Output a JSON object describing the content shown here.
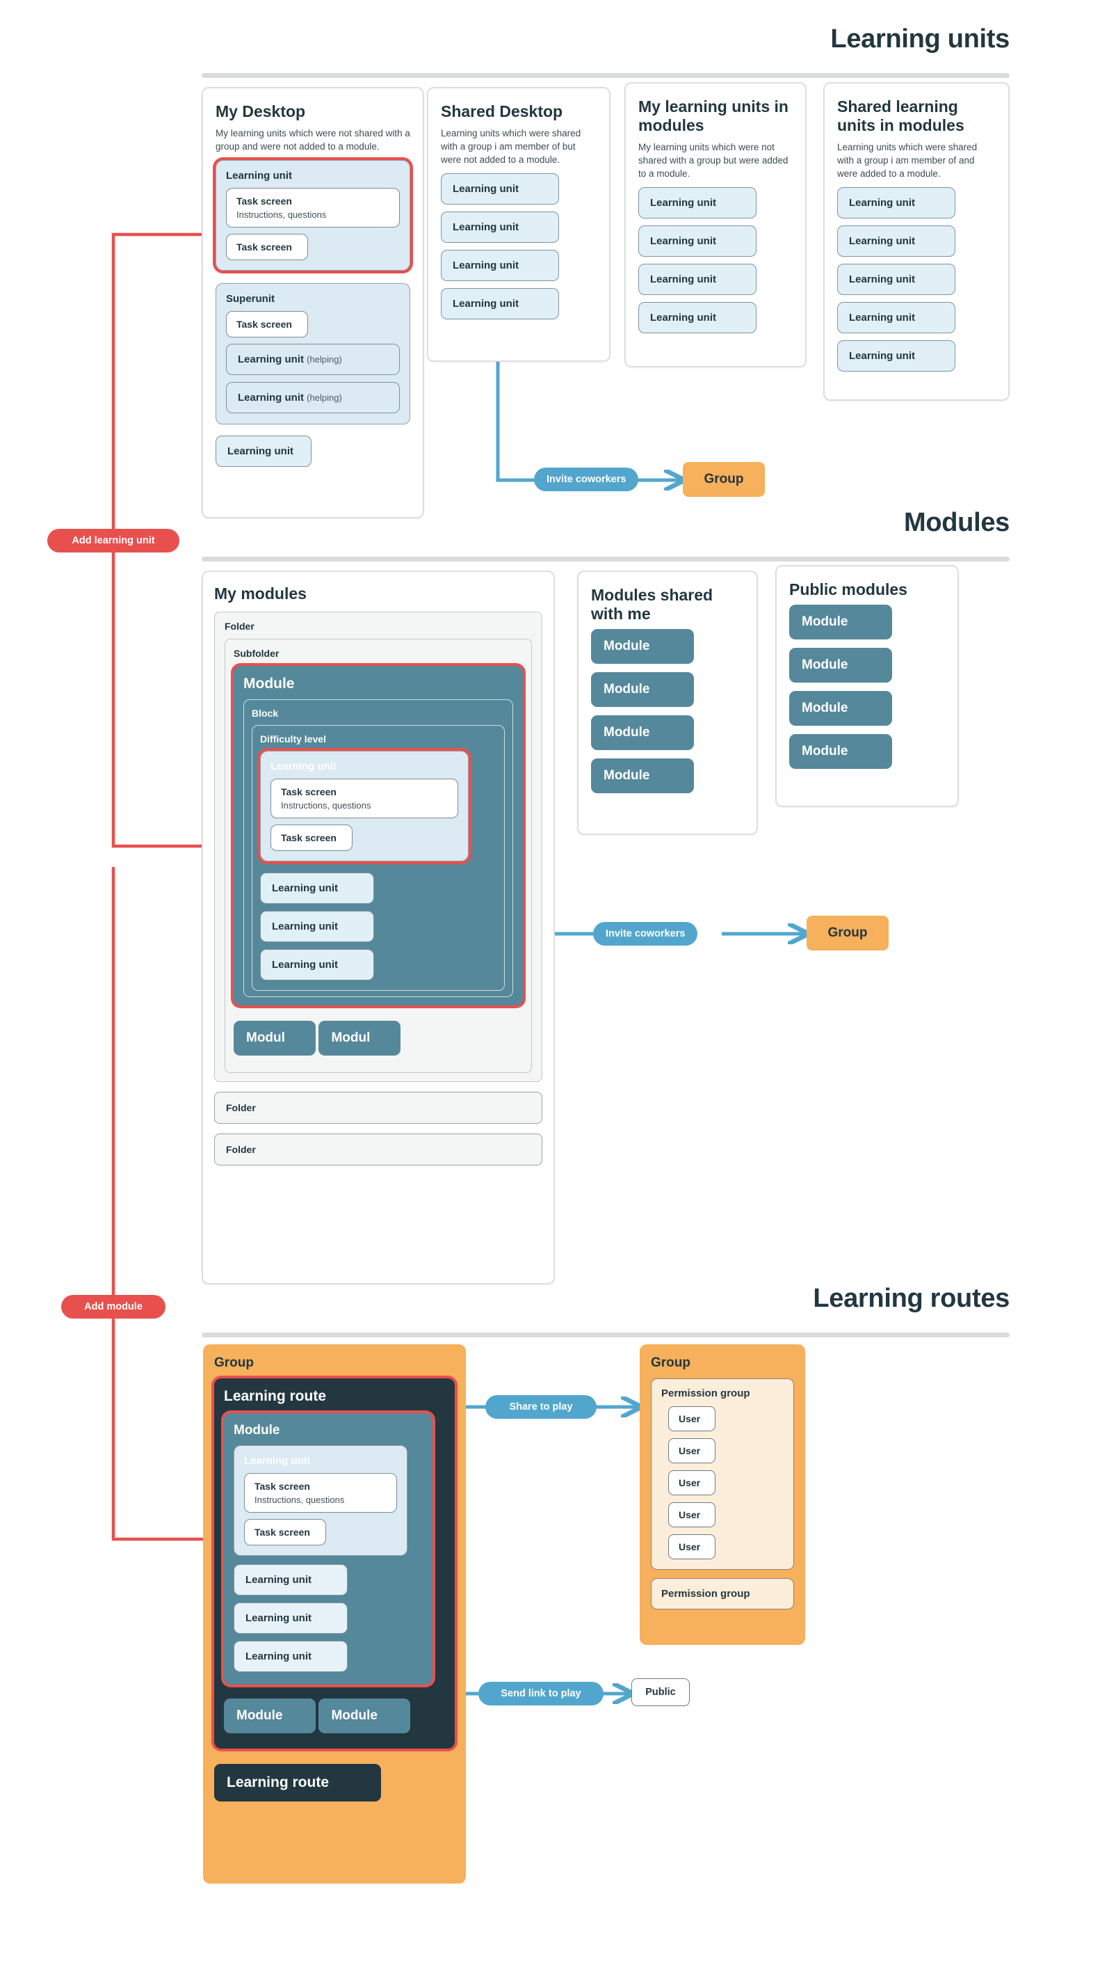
{
  "sections": [
    {
      "id": "learning-units",
      "title": "Learning units"
    },
    {
      "id": "modules",
      "title": "Modules"
    },
    {
      "id": "learning-routes",
      "title": "Learning routes"
    }
  ],
  "colors": {
    "accent_red": "#e8504e",
    "accent_blue": "#52a6cd",
    "module_teal": "#55889a",
    "group_orange": "#f7b05b",
    "route_dark": "#22373f",
    "unit_lightblue": "#e1eff6",
    "permission_cream": "#fdeedb"
  },
  "learning_units": {
    "my_desktop": {
      "title": "My Desktop",
      "description": "My learning units which were not shared with a group and were not added to a module.",
      "highlighted_unit": {
        "label": "Learning unit",
        "task_screens": [
          {
            "title": "Task screen",
            "subtitle": "Instructions, questions"
          },
          {
            "title": "Task screen",
            "subtitle": ""
          }
        ]
      },
      "superunit": {
        "label": "Superunit",
        "task_screen": "Task screen",
        "children": [
          {
            "label": "Learning unit",
            "suffix": "(helping)"
          },
          {
            "label": "Learning unit",
            "suffix": "(helping)"
          }
        ]
      },
      "loose_unit": "Learning unit"
    },
    "shared_desktop": {
      "title": "Shared Desktop",
      "description": "Learning units which were shared with a group i am member of but were not added to a module.",
      "units": [
        "Learning unit",
        "Learning unit",
        "Learning unit",
        "Learning unit"
      ]
    },
    "my_units_in_modules": {
      "title": "My learning units in modules",
      "description": "My learning units which were not shared with a group but were added to a module.",
      "units": [
        "Learning unit",
        "Learning unit",
        "Learning unit",
        "Learning unit"
      ]
    },
    "shared_units_in_modules": {
      "title": "Shared learning units in modules",
      "description": "Learning units which were shared with a group i am member of and were added to a module.",
      "units": [
        "Learning unit",
        "Learning unit",
        "Learning unit",
        "Learning unit",
        "Learning unit"
      ]
    },
    "invite_label": "Invite coworkers",
    "group_label": "Group"
  },
  "modules": {
    "my_modules": {
      "title": "My modules",
      "folder_label": "Folder",
      "subfolder_label": "Subfolder",
      "module": {
        "label": "Module",
        "block_label": "Block",
        "difficulty_label": "Difficulty level",
        "highlighted_unit": {
          "label": "Learning unit",
          "task_screens": [
            {
              "title": "Task screen",
              "subtitle": "Instructions, questions"
            },
            {
              "title": "Task screen",
              "subtitle": ""
            }
          ]
        },
        "units": [
          "Learning unit",
          "Learning unit",
          "Learning unit"
        ]
      },
      "sibling_modules": [
        "Modul",
        "Modul"
      ],
      "extra_folders": [
        "Folder",
        "Folder"
      ]
    },
    "shared_with_me": {
      "title": "Modules shared with me",
      "modules": [
        "Module",
        "Module",
        "Module",
        "Module"
      ]
    },
    "public_modules": {
      "title": "Public modules",
      "modules": [
        "Module",
        "Module",
        "Module",
        "Module"
      ]
    },
    "invite_label": "Invite coworkers",
    "group_label": "Group"
  },
  "learning_routes": {
    "group_label": "Group",
    "route": {
      "label": "Learning route",
      "module": {
        "label": "Module",
        "highlighted_unit": {
          "label": "Learning unit",
          "task_screens": [
            {
              "title": "Task screen",
              "subtitle": "Instructions, questions"
            },
            {
              "title": "Task screen",
              "subtitle": ""
            }
          ]
        },
        "units": [
          "Learning unit",
          "Learning unit",
          "Learning unit"
        ]
      },
      "sibling_modules": [
        "Module",
        "Module"
      ]
    },
    "second_route_label": "Learning route",
    "target_group": {
      "label": "Group",
      "permission_group_label": "Permission group",
      "users": [
        "User",
        "User",
        "User",
        "User",
        "User"
      ],
      "second_permission_group_label": "Permission group"
    },
    "share_to_play_label": "Share to play",
    "send_link_label": "Send link to play",
    "public_label": "Public"
  },
  "connectors": {
    "add_learning_unit": "Add learning unit",
    "add_module": "Add module"
  }
}
